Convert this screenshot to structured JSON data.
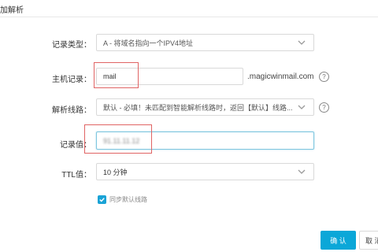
{
  "dialog": {
    "title": "加解析"
  },
  "form": {
    "record_type": {
      "label": "记录类型：",
      "value": "A - 将域名指向一个IPV4地址"
    },
    "host_record": {
      "label": "主机记录：",
      "value": "mail",
      "suffix": ".magicwinmail.com"
    },
    "resolution_line": {
      "label": "解析线路：",
      "value": "默认 - 必填！未匹配到智能解析线路时，返回【默认】线路..."
    },
    "record_value": {
      "label": "记录值：",
      "value": "91.11.11.12"
    },
    "ttl": {
      "label": "TTL值：",
      "value": "10 分钟"
    },
    "sync_default": {
      "label": "同步默认线路",
      "checked": true
    }
  },
  "buttons": {
    "ok": "确 认",
    "cancel": "取 消"
  },
  "icons": {
    "help": "?",
    "chevron": "chevron-down-icon",
    "check": "check-icon"
  },
  "colors": {
    "primary": "#0ba7d8",
    "annotation": "#e06464",
    "focus_border": "#7fc6df"
  }
}
